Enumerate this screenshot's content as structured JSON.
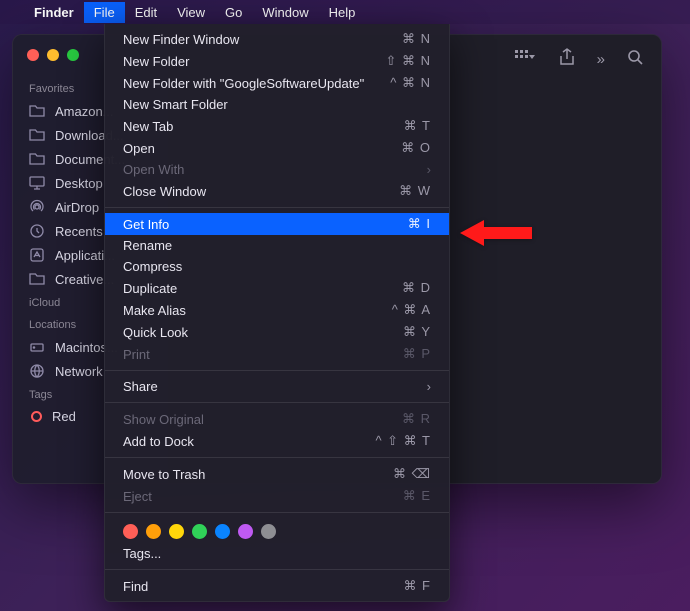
{
  "menubar": {
    "items": [
      "Finder",
      "File",
      "Edit",
      "View",
      "Go",
      "Window",
      "Help"
    ],
    "active_index": 1
  },
  "sidebar": {
    "sections": [
      {
        "header": "Favorites",
        "items": [
          {
            "icon": "folder",
            "label": "Amazon..."
          },
          {
            "icon": "folder",
            "label": "Download..."
          },
          {
            "icon": "folder",
            "label": "Document..."
          },
          {
            "icon": "desktop",
            "label": "Desktop"
          },
          {
            "icon": "airdrop",
            "label": "AirDrop"
          },
          {
            "icon": "clock",
            "label": "Recents"
          },
          {
            "icon": "app",
            "label": "Applicati..."
          },
          {
            "icon": "folder",
            "label": "Creative..."
          }
        ]
      },
      {
        "header": "iCloud",
        "items": []
      },
      {
        "header": "Locations",
        "items": [
          {
            "icon": "disk",
            "label": "Macintos..."
          },
          {
            "icon": "globe",
            "label": "Network"
          }
        ]
      },
      {
        "header": "Tags",
        "items": [
          {
            "icon": "tag-red",
            "label": "Red"
          }
        ]
      }
    ]
  },
  "dropdown": [
    {
      "type": "item",
      "label": "New Finder Window",
      "shortcut": "⌘ N"
    },
    {
      "type": "item",
      "label": "New Folder",
      "shortcut": "⇧ ⌘ N"
    },
    {
      "type": "item",
      "label": "New Folder with \"GoogleSoftwareUpdate\"",
      "shortcut": "^ ⌘ N"
    },
    {
      "type": "item",
      "label": "New Smart Folder",
      "shortcut": ""
    },
    {
      "type": "item",
      "label": "New Tab",
      "shortcut": "⌘ T"
    },
    {
      "type": "item",
      "label": "Open",
      "shortcut": "⌘ O"
    },
    {
      "type": "item",
      "label": "Open With",
      "submenu": true,
      "disabled": true
    },
    {
      "type": "item",
      "label": "Close Window",
      "shortcut": "⌘ W"
    },
    {
      "type": "sep"
    },
    {
      "type": "item",
      "label": "Get Info",
      "shortcut": "⌘ I",
      "highlighted": true
    },
    {
      "type": "item",
      "label": "Rename",
      "shortcut": ""
    },
    {
      "type": "item",
      "label": "Compress",
      "shortcut": ""
    },
    {
      "type": "item",
      "label": "Duplicate",
      "shortcut": "⌘ D"
    },
    {
      "type": "item",
      "label": "Make Alias",
      "shortcut": "^ ⌘ A"
    },
    {
      "type": "item",
      "label": "Quick Look",
      "shortcut": "⌘ Y"
    },
    {
      "type": "item",
      "label": "Print",
      "shortcut": "⌘ P",
      "disabled": true
    },
    {
      "type": "sep"
    },
    {
      "type": "item",
      "label": "Share",
      "submenu": true
    },
    {
      "type": "sep"
    },
    {
      "type": "item",
      "label": "Show Original",
      "shortcut": "⌘ R",
      "disabled": true
    },
    {
      "type": "item",
      "label": "Add to Dock",
      "shortcut": "^ ⇧ ⌘ T"
    },
    {
      "type": "sep"
    },
    {
      "type": "item",
      "label": "Move to Trash",
      "shortcut": "⌘ ⌫"
    },
    {
      "type": "item",
      "label": "Eject",
      "shortcut": "⌘ E",
      "disabled": true
    },
    {
      "type": "sep"
    },
    {
      "type": "tags",
      "colors": [
        "#ff5f57",
        "#ff9f0a",
        "#ffd60a",
        "#30d158",
        "#0a84ff",
        "#bf5af2",
        "#8e8e93"
      ]
    },
    {
      "type": "item",
      "label": "Tags...",
      "shortcut": ""
    },
    {
      "type": "sep"
    },
    {
      "type": "item",
      "label": "Find",
      "shortcut": "⌘ F"
    }
  ]
}
